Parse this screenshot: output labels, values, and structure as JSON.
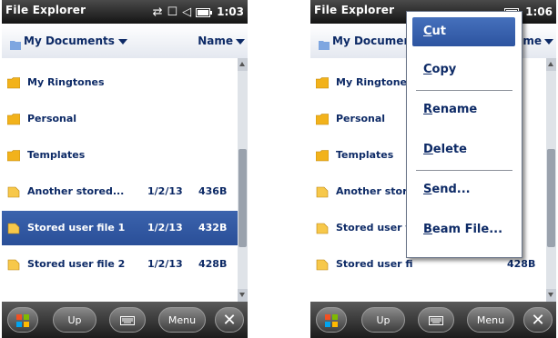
{
  "left_screen": {
    "app_title": "File Explorer",
    "time": "1:03",
    "status_icons": [
      "sync-icon",
      "network-icon",
      "volume-icon",
      "battery-icon"
    ],
    "path": "My Documents",
    "sort": "Name",
    "files": [
      {
        "name": "My Ringtones",
        "date": "",
        "size": "",
        "type": "folder",
        "selected": false
      },
      {
        "name": "Personal",
        "date": "",
        "size": "",
        "type": "folder",
        "selected": false
      },
      {
        "name": "Templates",
        "date": "",
        "size": "",
        "type": "folder",
        "selected": false
      },
      {
        "name": "Another stored...",
        "date": "1/2/13",
        "size": "436B",
        "type": "file",
        "selected": false
      },
      {
        "name": "Stored user file 1",
        "date": "1/2/13",
        "size": "432B",
        "type": "file",
        "selected": true
      },
      {
        "name": "Stored user file 2",
        "date": "1/2/13",
        "size": "428B",
        "type": "file",
        "selected": false
      }
    ],
    "softkeys": {
      "up": "Up",
      "menu": "Menu"
    }
  },
  "right_screen": {
    "app_title": "File Explorer",
    "time": "1:06",
    "path": "My Documen",
    "sort": "ame",
    "files": [
      {
        "name": "My Ringtone",
        "date": "",
        "size": "",
        "type": "folder"
      },
      {
        "name": "Personal",
        "date": "",
        "size": "",
        "type": "folder"
      },
      {
        "name": "Templates",
        "date": "",
        "size": "",
        "type": "folder"
      },
      {
        "name": "Another stor",
        "date": "",
        "size": "6B",
        "type": "file"
      },
      {
        "name": "Stored user f",
        "date": "",
        "size": "2B",
        "type": "file"
      },
      {
        "name": "Stored user fi",
        "date": "",
        "size": "428B",
        "type": "file"
      }
    ],
    "context_menu": [
      {
        "label": "Cut",
        "highlighted": true
      },
      {
        "label": "Copy",
        "highlighted": false
      },
      {
        "label": "Rename",
        "highlighted": false
      },
      {
        "label": "Delete",
        "highlighted": false
      },
      {
        "label": "Send...",
        "highlighted": false
      },
      {
        "label": "Beam File...",
        "highlighted": false
      }
    ],
    "softkeys": {
      "up": "Up",
      "menu": "Menu"
    }
  },
  "colors": {
    "accent": "#2d54a0",
    "text": "#0d2a66",
    "titlebar": "#141414",
    "folder": "#f2b21b"
  }
}
